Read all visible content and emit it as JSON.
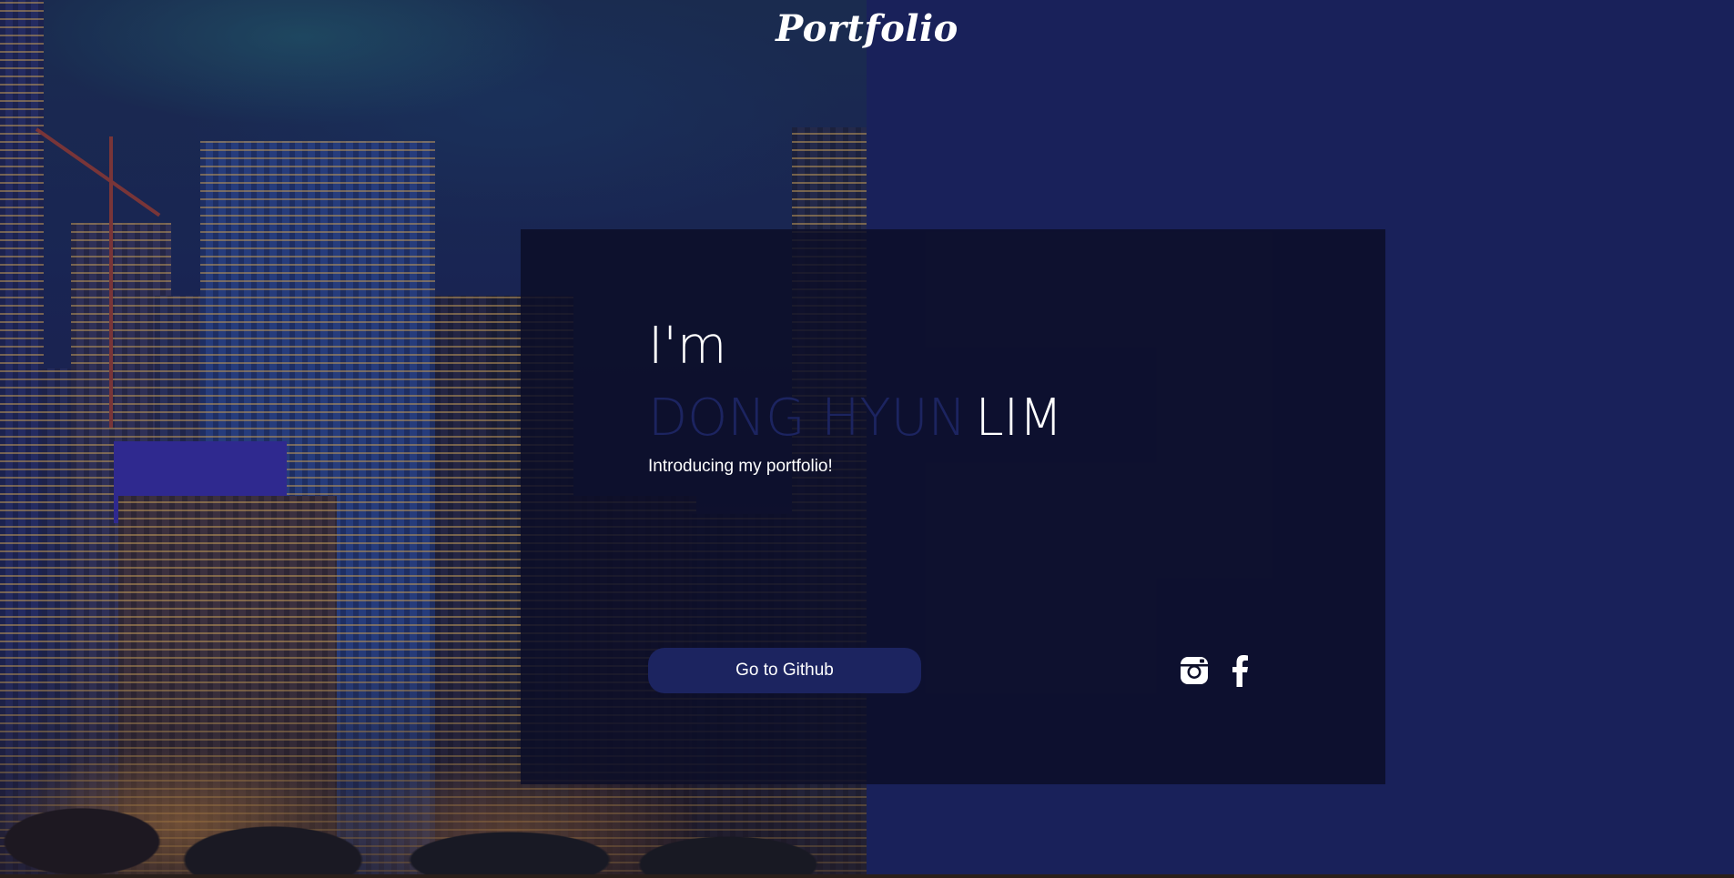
{
  "header": {
    "brand": "Portfolio"
  },
  "hero": {
    "greeting": "I'm",
    "name_first": "DONG HYUN",
    "name_last": "LIM",
    "tagline": "Introducing my portfolio!",
    "cta_label": "Go to Github"
  },
  "social": [
    {
      "icon": "instagram-icon"
    },
    {
      "icon": "facebook-icon"
    }
  ],
  "colors": {
    "background": "#19215a",
    "card": "#0c0e28",
    "accent": "#1c2460",
    "text": "#ffffff"
  }
}
